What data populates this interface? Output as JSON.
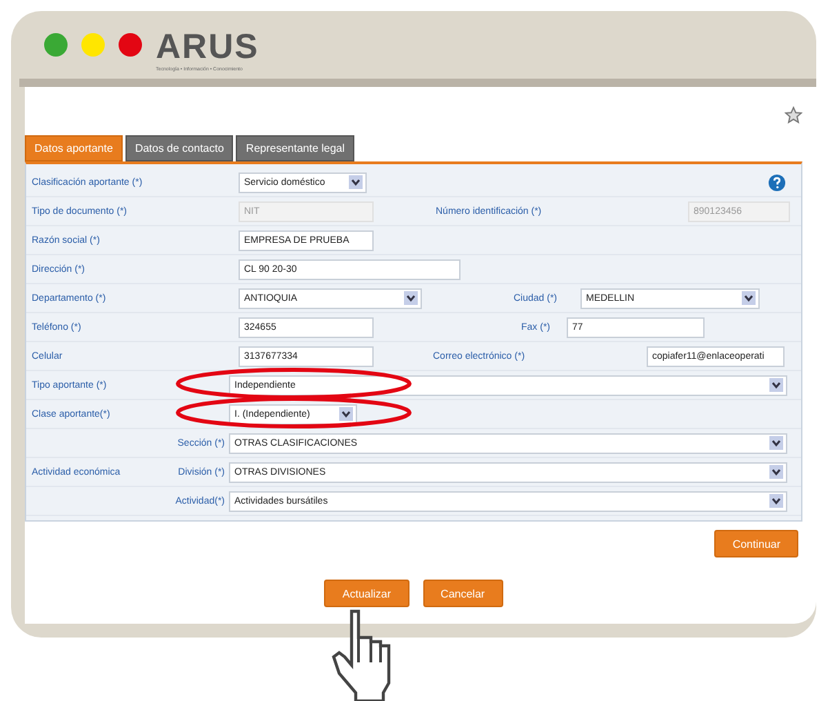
{
  "logo": {
    "text": "ARUS",
    "tagline": "Tecnología • Información • Conocimiento"
  },
  "tabs": [
    {
      "label": "Datos aportante",
      "selected": true
    },
    {
      "label": "Datos de contacto",
      "selected": false
    },
    {
      "label": "Representante legal",
      "selected": false
    }
  ],
  "form_rows": [
    {
      "items": [
        {
          "kind": "label",
          "text": "Clasificación aportante (*)"
        },
        {
          "kind": "select",
          "text": "Servicio doméstico"
        },
        {
          "kind": "help"
        }
      ]
    },
    {
      "items": [
        {
          "kind": "label",
          "text": "Tipo de documento (*)"
        },
        {
          "kind": "disabled",
          "text": "NIT"
        },
        {
          "kind": "label",
          "text": "Número identificación (*)"
        },
        {
          "kind": "disabled",
          "text": "890123456"
        }
      ]
    },
    {
      "items": [
        {
          "kind": "label",
          "text": "Razón social (*)"
        },
        {
          "kind": "input",
          "text": "EMPRESA DE PRUEBA"
        }
      ]
    },
    {
      "items": [
        {
          "kind": "label",
          "text": "Dirección (*)"
        },
        {
          "kind": "input",
          "text": "CL 90 20-30"
        }
      ]
    },
    {
      "items": [
        {
          "kind": "label",
          "text": "Departamento (*)"
        },
        {
          "kind": "select",
          "text": "ANTIOQUIA"
        },
        {
          "kind": "label",
          "text": "Ciudad (*)"
        },
        {
          "kind": "select",
          "text": "MEDELLIN"
        }
      ]
    },
    {
      "items": [
        {
          "kind": "label",
          "text": "Teléfono (*)"
        },
        {
          "kind": "input",
          "text": "324655"
        },
        {
          "kind": "label",
          "text": "Fax (*)"
        },
        {
          "kind": "input",
          "text": "77"
        }
      ]
    },
    {
      "items": [
        {
          "kind": "label",
          "text": "Celular"
        },
        {
          "kind": "input",
          "text": "3137677334"
        },
        {
          "kind": "label",
          "text": "Correo electrónico (*)"
        },
        {
          "kind": "input",
          "text": "copiafer11@enlaceoperati"
        }
      ]
    },
    {
      "items": [
        {
          "kind": "label",
          "text": "Tipo aportante (*)"
        },
        {
          "kind": "select",
          "text": "Independiente"
        }
      ]
    },
    {
      "items": [
        {
          "kind": "label",
          "text": "Clase aportante(*)"
        },
        {
          "kind": "select",
          "text": "I. (Independiente)"
        }
      ]
    },
    {
      "items": [
        {
          "kind": "label",
          "text": "Sección (*)"
        },
        {
          "kind": "select",
          "text": "OTRAS CLASIFICACIONES"
        }
      ]
    },
    {
      "items": [
        {
          "kind": "label",
          "text": "Actividad económica"
        },
        {
          "kind": "label",
          "text": "División (*)"
        },
        {
          "kind": "select",
          "text": "OTRAS DIVISIONES"
        }
      ]
    },
    {
      "items": [
        {
          "kind": "label",
          "text": "Actividad(*)"
        },
        {
          "kind": "select",
          "text": "Actividades bursátiles"
        }
      ]
    }
  ],
  "continue_button": "Continuar",
  "buttons": [
    "Actualizar",
    "Cancelar"
  ]
}
